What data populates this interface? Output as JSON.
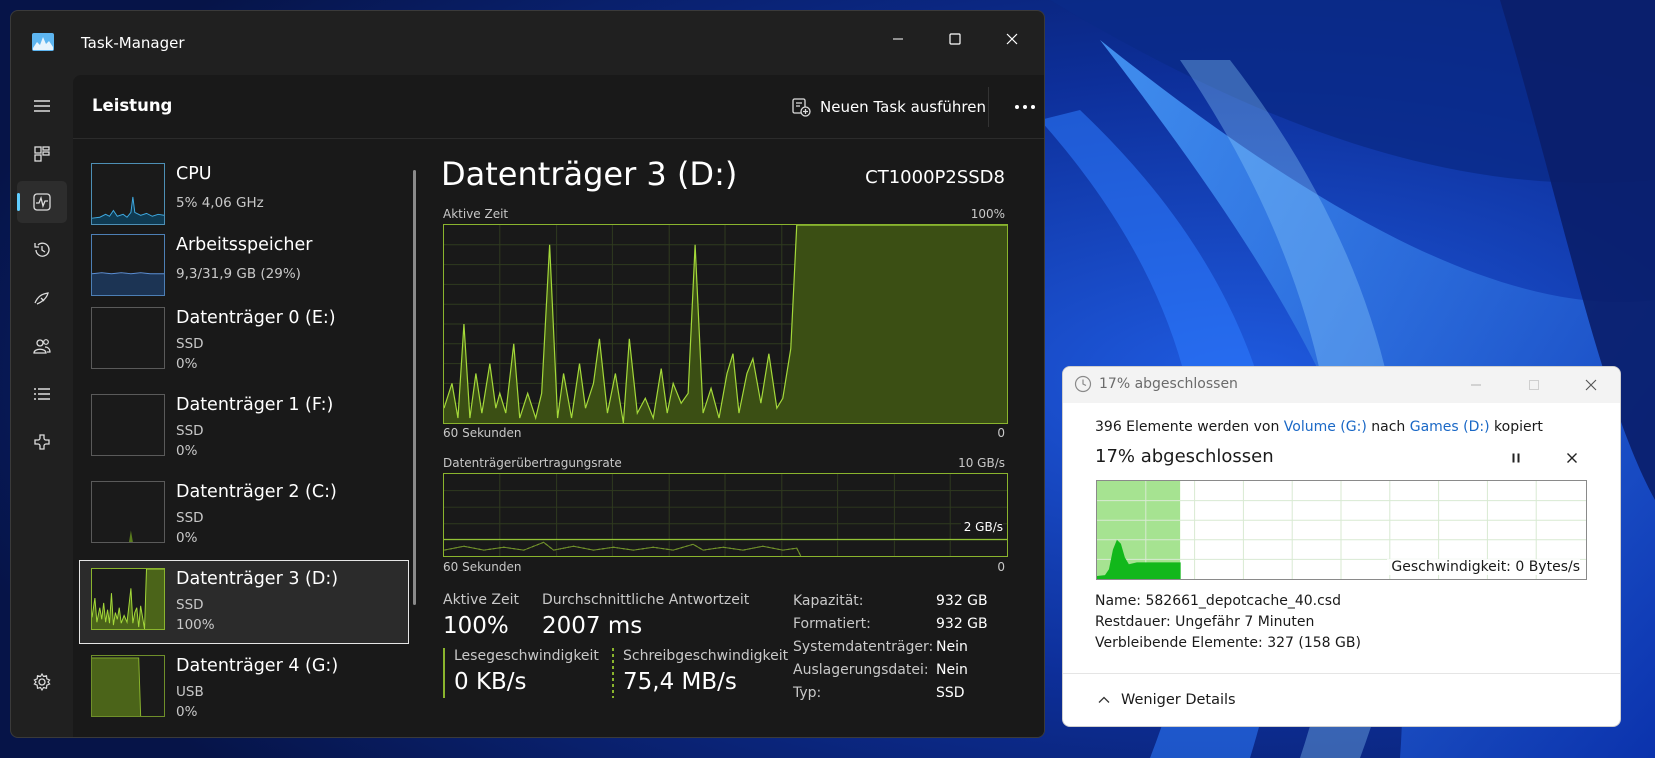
{
  "taskmanager": {
    "title": "Task-Manager",
    "page_title": "Leistung",
    "run_task_label": "Neuen Task ausführen",
    "more_glyph": "•••",
    "accent_color": "#60cdff",
    "disk_color": "#8ab42d"
  },
  "perf_items": [
    {
      "title": "CPU",
      "line1": "5%  4,06 GHz"
    },
    {
      "title": "Arbeitsspeicher",
      "line1": "9,3/31,9 GB (29%)"
    },
    {
      "title": "Datenträger 0 (E:)",
      "line1": "SSD",
      "line2": "0%"
    },
    {
      "title": "Datenträger 1 (F:)",
      "line1": "SSD",
      "line2": "0%"
    },
    {
      "title": "Datenträger 2 (C:)",
      "line1": "SSD",
      "line2": "0%"
    },
    {
      "title": "Datenträger 3 (D:)",
      "line1": "SSD",
      "line2": "100%"
    },
    {
      "title": "Datenträger 4 (G:)",
      "line1": "USB",
      "line2": "0%"
    }
  ],
  "detail": {
    "title": "Datenträger 3 (D:)",
    "model": "CT1000P2SSD8",
    "graph1": {
      "label": "Aktive Zeit",
      "max": "100%",
      "left": "60 Sekunden",
      "right": "0"
    },
    "graph2": {
      "label": "Datenträgerübertragungsrate",
      "max": "10 GB/s",
      "marker": "2 GB/s",
      "left": "60 Sekunden",
      "right": "0"
    },
    "stats": {
      "active_label": "Aktive Zeit",
      "active_value": "100%",
      "resp_label": "Durchschnittliche Antwortzeit",
      "resp_value": "2007 ms",
      "read_label": "Lesegeschwindigkeit",
      "read_value": "0 KB/s",
      "write_label": "Schreibgeschwindigkeit",
      "write_value": "75,4 MB/s"
    },
    "props": [
      {
        "label": "Kapazität:",
        "value": "932 GB"
      },
      {
        "label": "Formatiert:",
        "value": "932 GB"
      },
      {
        "label": "Systemdatenträger:",
        "value": "Nein"
      },
      {
        "label": "Auslagerungsdatei:",
        "value": "Nein"
      },
      {
        "label": "Typ:",
        "value": "SSD"
      }
    ]
  },
  "copy_dialog": {
    "title": "17% abgeschlossen",
    "line_prefix": "396 Elemente werden von ",
    "source": "Volume (G:)",
    "line_mid": " nach ",
    "dest": "Games (D:)",
    "line_suffix": " kopiert",
    "progress_text": "17% abgeschlossen",
    "progress_fraction": 0.17,
    "speed": "Geschwindigkeit: 0 Bytes/s",
    "name_label": "Name:",
    "name_value": "582661_depotcache_40.csd",
    "time_label": "Restdauer:",
    "time_value": "Ungefähr 7 Minuten",
    "remaining_label": "Verbleibende Elemente:",
    "remaining_value": "327 (158 GB)",
    "less_details": "Weniger Details"
  }
}
